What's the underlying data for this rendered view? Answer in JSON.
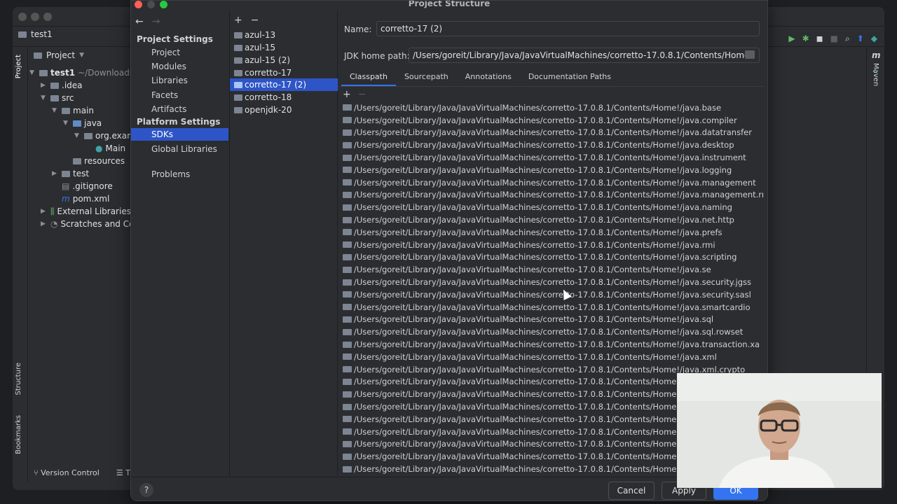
{
  "ide": {
    "project_name": "test1",
    "panel_title": "Project",
    "tree": [
      {
        "label": "test1",
        "suffix": "~/Downloads/t"
      },
      {
        "label": ".idea"
      },
      {
        "label": "src"
      },
      {
        "label": "main"
      },
      {
        "label": "java"
      },
      {
        "label": "org.exam"
      },
      {
        "label": "Main"
      },
      {
        "label": "resources"
      },
      {
        "label": "test"
      },
      {
        "label": ".gitignore"
      },
      {
        "label": "pom.xml"
      },
      {
        "label": "External Libraries"
      },
      {
        "label": "Scratches and Cons"
      }
    ],
    "left_strip": {
      "project": "Project",
      "structure": "Structure",
      "bookmarks": "Bookmarks"
    },
    "right_strip": {
      "maven": "Maven"
    },
    "bottom": {
      "version_control": "Version Control",
      "todo": "TO"
    }
  },
  "dialog": {
    "title": "Project Structure",
    "nav": {
      "project_settings": "Project Settings",
      "project_items": [
        "Project",
        "Modules",
        "Libraries",
        "Facets",
        "Artifacts"
      ],
      "platform_settings": "Platform Settings",
      "platform_items": [
        "SDKs",
        "Global Libraries"
      ],
      "problems": "Problems",
      "selected": "SDKs"
    },
    "sdks": {
      "items": [
        "azul-13",
        "azul-15",
        "azul-15 (2)",
        "corretto-17",
        "corretto-17 (2)",
        "corretto-18",
        "openjdk-20"
      ],
      "selected": "corretto-17 (2)"
    },
    "name_label": "Name:",
    "name_value": "corretto-17 (2)",
    "jdk_home_label": "JDK home path:",
    "jdk_home_value": "/Users/goreit/Library/Java/JavaVirtualMachines/corretto-17.0.8.1/Contents/Home",
    "tabs": [
      "Classpath",
      "Sourcepath",
      "Annotations",
      "Documentation Paths"
    ],
    "active_tab": "Classpath",
    "classpath": [
      "/Users/goreit/Library/Java/JavaVirtualMachines/corretto-17.0.8.1/Contents/Home!/java.base",
      "/Users/goreit/Library/Java/JavaVirtualMachines/corretto-17.0.8.1/Contents/Home!/java.compiler",
      "/Users/goreit/Library/Java/JavaVirtualMachines/corretto-17.0.8.1/Contents/Home!/java.datatransfer",
      "/Users/goreit/Library/Java/JavaVirtualMachines/corretto-17.0.8.1/Contents/Home!/java.desktop",
      "/Users/goreit/Library/Java/JavaVirtualMachines/corretto-17.0.8.1/Contents/Home!/java.instrument",
      "/Users/goreit/Library/Java/JavaVirtualMachines/corretto-17.0.8.1/Contents/Home!/java.logging",
      "/Users/goreit/Library/Java/JavaVirtualMachines/corretto-17.0.8.1/Contents/Home!/java.management",
      "/Users/goreit/Library/Java/JavaVirtualMachines/corretto-17.0.8.1/Contents/Home!/java.management.rmi",
      "/Users/goreit/Library/Java/JavaVirtualMachines/corretto-17.0.8.1/Contents/Home!/java.naming",
      "/Users/goreit/Library/Java/JavaVirtualMachines/corretto-17.0.8.1/Contents/Home!/java.net.http",
      "/Users/goreit/Library/Java/JavaVirtualMachines/corretto-17.0.8.1/Contents/Home!/java.prefs",
      "/Users/goreit/Library/Java/JavaVirtualMachines/corretto-17.0.8.1/Contents/Home!/java.rmi",
      "/Users/goreit/Library/Java/JavaVirtualMachines/corretto-17.0.8.1/Contents/Home!/java.scripting",
      "/Users/goreit/Library/Java/JavaVirtualMachines/corretto-17.0.8.1/Contents/Home!/java.se",
      "/Users/goreit/Library/Java/JavaVirtualMachines/corretto-17.0.8.1/Contents/Home!/java.security.jgss",
      "/Users/goreit/Library/Java/JavaVirtualMachines/corretto-17.0.8.1/Contents/Home!/java.security.sasl",
      "/Users/goreit/Library/Java/JavaVirtualMachines/corretto-17.0.8.1/Contents/Home!/java.smartcardio",
      "/Users/goreit/Library/Java/JavaVirtualMachines/corretto-17.0.8.1/Contents/Home!/java.sql",
      "/Users/goreit/Library/Java/JavaVirtualMachines/corretto-17.0.8.1/Contents/Home!/java.sql.rowset",
      "/Users/goreit/Library/Java/JavaVirtualMachines/corretto-17.0.8.1/Contents/Home!/java.transaction.xa",
      "/Users/goreit/Library/Java/JavaVirtualMachines/corretto-17.0.8.1/Contents/Home!/java.xml",
      "/Users/goreit/Library/Java/JavaVirtualMachines/corretto-17.0.8.1/Contents/Home!/java.xml.crypto",
      "/Users/goreit/Library/Java/JavaVirtualMachines/corretto-17.0.8.1/Contents/Home!/jdk.a",
      "/Users/goreit/Library/Java/JavaVirtualMachines/corretto-17.0.8.1/Contents/Home!/jdk.a",
      "/Users/goreit/Library/Java/JavaVirtualMachines/corretto-17.0.8.1/Contents/Home!/jdk.c",
      "/Users/goreit/Library/Java/JavaVirtualMachines/corretto-17.0.8.1/Contents/Home!/jdk.c",
      "/Users/goreit/Library/Java/JavaVirtualMachines/corretto-17.0.8.1/Contents/Home!/jdk.c",
      "/Users/goreit/Library/Java/JavaVirtualMachines/corretto-17.0.8.1/Contents/Home!/jdk.c",
      "/Users/goreit/Library/Java/JavaVirtualMachines/corretto-17.0.8.1/Contents/Home!/jdk.c",
      "/Users/goreit/Library/Java/JavaVirtualMachines/corretto-17.0.8.1/Contents/Home!/jdk.e"
    ],
    "buttons": {
      "help": "?",
      "cancel": "Cancel",
      "apply": "Apply",
      "ok": "OK"
    }
  },
  "colors": {
    "accent": "#3574f0",
    "selection": "#2e55c7",
    "background": "#2b2d30"
  }
}
